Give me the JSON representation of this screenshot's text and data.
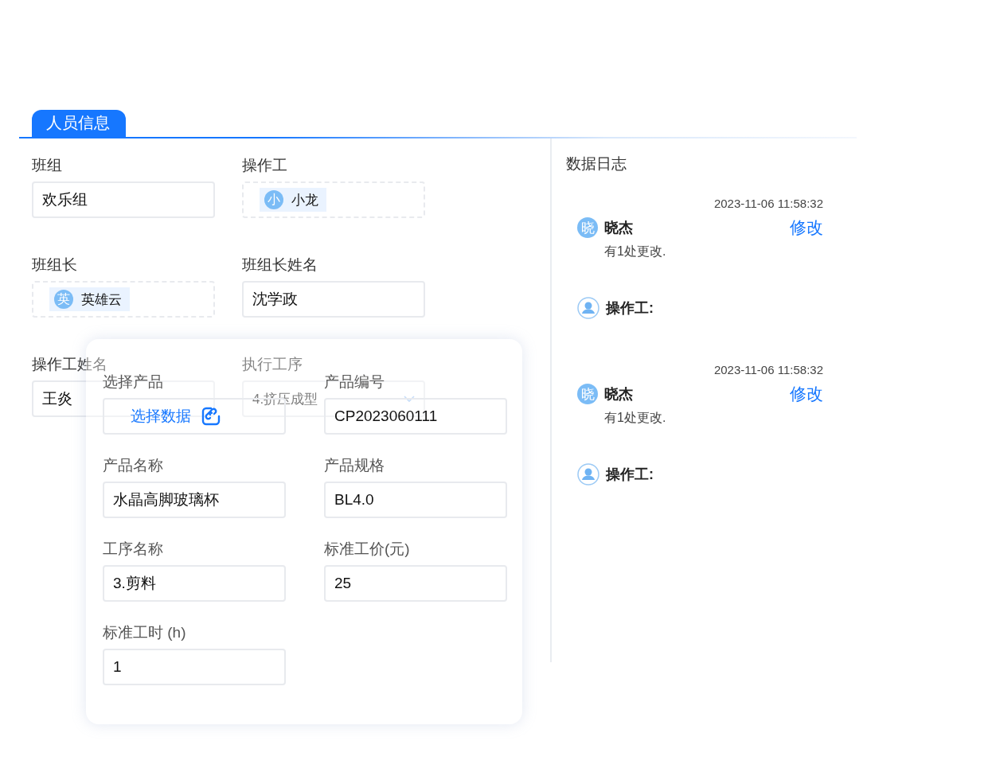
{
  "tab": {
    "label": "人员信息",
    "selected": true
  },
  "form": {
    "fields": [
      {
        "kind": "input",
        "label": "班组",
        "value": "欢乐组"
      },
      {
        "kind": "person",
        "label": "操作工",
        "avatar": "小",
        "value": "小龙"
      },
      {
        "kind": "person",
        "label": "班组长",
        "avatar": "英",
        "value": "英雄云"
      },
      {
        "kind": "input",
        "label": "班组长姓名",
        "value": "沈学政"
      },
      {
        "kind": "input",
        "label": "操作工姓名",
        "value": "王炎"
      },
      {
        "kind": "select",
        "label": "执行工序",
        "value": "4.挤压成型"
      }
    ]
  },
  "dialog": {
    "fields": [
      {
        "kind": "link",
        "label": "选择产品",
        "value": "选择数据"
      },
      {
        "kind": "input",
        "label": "产品编号",
        "value": "CP2023060111"
      },
      {
        "kind": "input",
        "label": "产品名称",
        "value": "水晶高脚玻璃杯"
      },
      {
        "kind": "input",
        "label": "产品规格",
        "value": "BL4.0"
      },
      {
        "kind": "input",
        "label": "工序名称",
        "value": "3.剪料"
      },
      {
        "kind": "input",
        "label": "标准工价(元)",
        "value": "25"
      },
      {
        "kind": "input",
        "label": "标准工时 (h)",
        "value": "1"
      }
    ]
  },
  "log": {
    "title": "数据日志",
    "entries": [
      {
        "time": "2023-11-06 11:58:32",
        "avatar": "晓",
        "user": "晓杰",
        "action": "修改",
        "message": "有1处更改.",
        "operator_label": "操作工:"
      },
      {
        "time": "2023-11-06 11:58:32",
        "avatar": "晓",
        "user": "晓杰",
        "action": "修改",
        "message": "有1处更改.",
        "operator_label": "操作工:"
      }
    ]
  }
}
